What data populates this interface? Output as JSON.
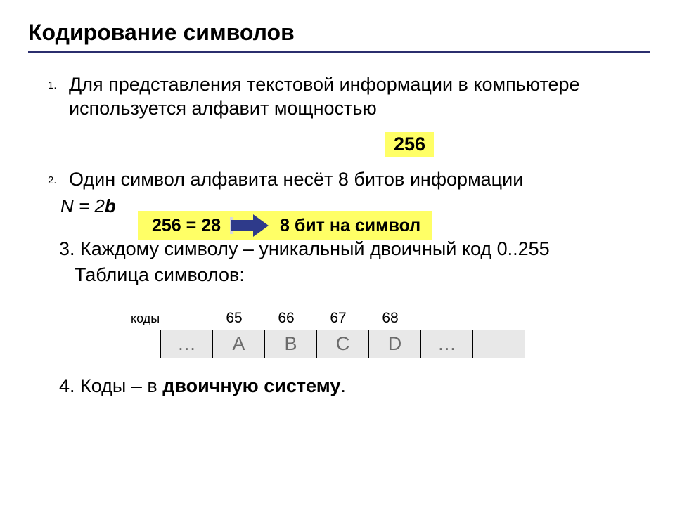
{
  "title": "Кодирование символов",
  "items": [
    {
      "num": "1.",
      "text": "Для представления текстовой информации  в компьютере используется алфавит мощностью"
    },
    {
      "num": "2.",
      "text": "Один символ алфавита несёт 8 битов информации"
    }
  ],
  "highlight256": "256",
  "formula": {
    "prefix": "N = 2",
    "b": "b"
  },
  "arrow": {
    "left": "256 = 28",
    "right": "8 бит на символ"
  },
  "item3": {
    "prefix": "3.   Каждому символу – уникальный двоичный код 0..255",
    "sub": "Таблица символов:"
  },
  "codes": {
    "label": "коды",
    "values": [
      "65",
      "66",
      "67",
      "68"
    ]
  },
  "chars": [
    "…",
    "A",
    "B",
    "C",
    "D",
    "…",
    ""
  ],
  "item4": {
    "prefix": "4. Коды – в ",
    "bold": "двоичную систему",
    "suffix": "."
  }
}
